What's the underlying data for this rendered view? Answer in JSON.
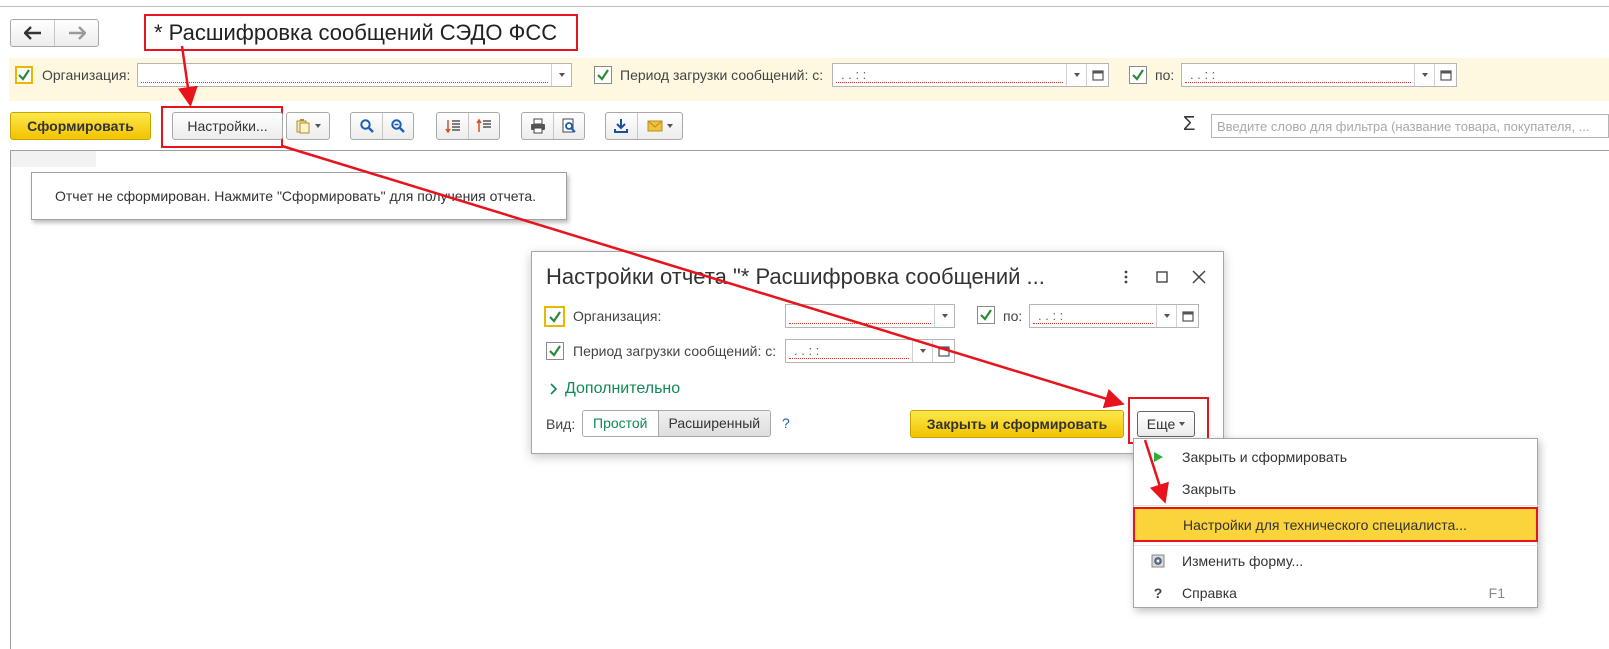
{
  "window": {
    "title": "* Расшифровка сообщений СЭДО ФСС"
  },
  "nav": {
    "back": "🡐",
    "forward": "🡒"
  },
  "filters": {
    "org_label": "Организация:",
    "org_value": "",
    "period_from_label": "Период загрузки сообщений: с:",
    "period_from_value": " .  .      :  :",
    "period_to_label": "по:",
    "period_to_value": " .  .      :  :"
  },
  "toolbar": {
    "generate_label": "Сформировать",
    "settings_label": "Настройки...",
    "sigma": "Σ",
    "search_placeholder": "Введите слово для фильтра (название товара, покупателя, ..."
  },
  "report": {
    "notice": "Отчет не сформирован. Нажмите \"Сформировать\" для получения отчета."
  },
  "dialog": {
    "title": "Настройки отчета \"* Расшифровка сообщений ...",
    "org_label": "Организация:",
    "org_value": "",
    "to_label": "по:",
    "to_value": " .  .      :  :",
    "from_label": "Период загрузки сообщений: с:",
    "from_value": " .  .      :  :",
    "advanced_label": "Дополнительно",
    "view_label": "Вид:",
    "view_simple": "Простой",
    "view_extended": "Расширенный",
    "help": "?",
    "close_generate_label": "Закрыть и сформировать",
    "more_label": "Еще"
  },
  "menu": {
    "items": [
      {
        "label": "Закрыть и сформировать",
        "icon": "play-icon"
      },
      {
        "label": "Закрыть",
        "icon": ""
      },
      {
        "label": "Настройки для технического специалиста...",
        "icon": ""
      },
      {
        "label": "Изменить форму...",
        "icon": "form-settings-icon"
      },
      {
        "label": "Справка",
        "icon": "help-icon",
        "icon_text": "?",
        "shortcut": "F1"
      }
    ]
  },
  "colors": {
    "annotation_red": "#e8141d",
    "accent_yellow": "#f5d020",
    "link_green": "#0e8a55",
    "filter_band": "#fdf8df"
  }
}
